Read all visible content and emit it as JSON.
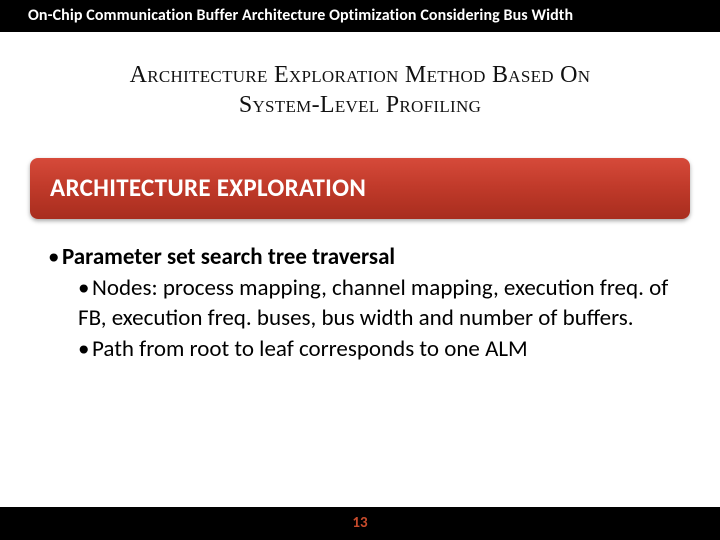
{
  "header": {
    "title": "On-Chip Communication Buffer Architecture Optimization Considering Bus Width"
  },
  "subtitle": {
    "line1": "Architecture Exploration Method Based On",
    "line2": "System-Level Profiling"
  },
  "section": {
    "title": "ARCHITECTURE EXPLORATION"
  },
  "bullets": {
    "main": "Parameter set search tree traversal",
    "sub1": "Nodes: process mapping, channel mapping, execution freq. of FB,  execution freq. buses, bus width and number of buffers.",
    "sub2": "Path from root to leaf corresponds to one ALM"
  },
  "footer": {
    "page": "13"
  }
}
